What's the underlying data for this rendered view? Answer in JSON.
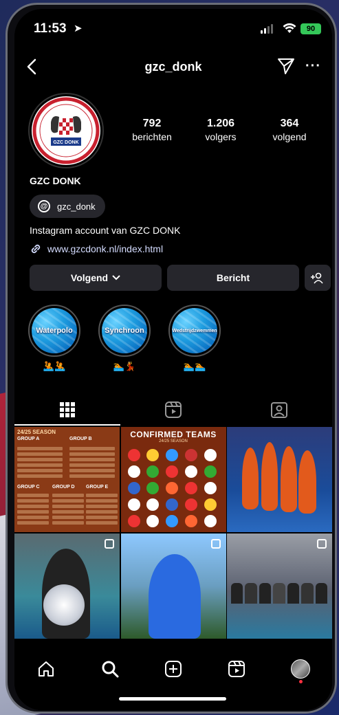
{
  "status_bar": {
    "time": "11:53",
    "battery": "90"
  },
  "header": {
    "username": "gzc_donk",
    "more": "···"
  },
  "profile": {
    "display_name": "GZC DONK",
    "logo_text": "GZC DONK",
    "stats": [
      {
        "value": "792",
        "label": "berichten"
      },
      {
        "value": "1.206",
        "label": "volgers"
      },
      {
        "value": "364",
        "label": "volgend"
      }
    ],
    "threads_handle": "gzc_donk",
    "bio": "Instagram account van GZC DONK",
    "website": "www.gzcdonk.nl/index.html"
  },
  "actions": {
    "follow": "Volgend",
    "message": "Bericht"
  },
  "highlights": [
    {
      "label": "Waterpolo"
    },
    {
      "label": "Synchroon"
    },
    {
      "label": "Wedstrijdzwemmen"
    }
  ],
  "grid": {
    "post1_header": "24/25 SEASON",
    "post1_groups": [
      "GROUP A",
      "GROUP B",
      "GROUP C",
      "GROUP D",
      "GROUP E"
    ],
    "post2_title": "CONFIRMED TEAMS",
    "post2_subtitle": "24/25 SEASON"
  },
  "colors": {
    "background": "#000000",
    "button": "#26262c",
    "link": "#d4dcff",
    "notification": "#ff3040"
  }
}
